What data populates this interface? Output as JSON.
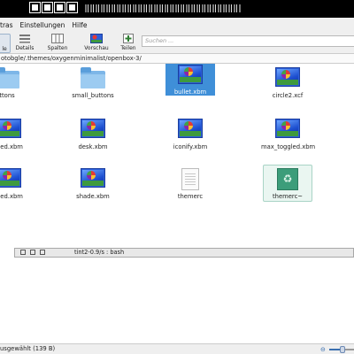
{
  "menu": {
    "extras": "tras",
    "settings": "Einstellungen",
    "help": "Hilfe"
  },
  "toolbar": {
    "icons_label": "le",
    "details_label": "Details",
    "columns_label": "Spalten",
    "preview_label": "Vorschau",
    "split_label": "Teilen"
  },
  "search": {
    "placeholder": "Suchen ..."
  },
  "path": "otobgle/.themes/oxygenminimalist/openbox-3/",
  "files": [
    {
      "name": "ttons",
      "type": "folder"
    },
    {
      "name": "small_buttons",
      "type": "folder"
    },
    {
      "name": "bullet.xbm",
      "type": "image",
      "selected": true
    },
    {
      "name": "circle2.xcf",
      "type": "image"
    },
    {
      "name": "gled.xbm",
      "type": "image"
    },
    {
      "name": "desk.xbm",
      "type": "image"
    },
    {
      "name": "iconify.xbm",
      "type": "image"
    },
    {
      "name": "max_toggled.xbm",
      "type": "image"
    },
    {
      "name": "gled.xbm",
      "type": "image"
    },
    {
      "name": "shade.xbm",
      "type": "image"
    },
    {
      "name": "themerc",
      "type": "text"
    },
    {
      "name": "themerc~",
      "type": "backup"
    }
  ],
  "terminal": {
    "text": "tint2-0.9/s : bash"
  },
  "status": {
    "text": "usgewählt (139 B)",
    "zoom_level": 0.55
  },
  "colors": {
    "selection": "#3f8fd8",
    "accent": "#3a6fb0"
  }
}
